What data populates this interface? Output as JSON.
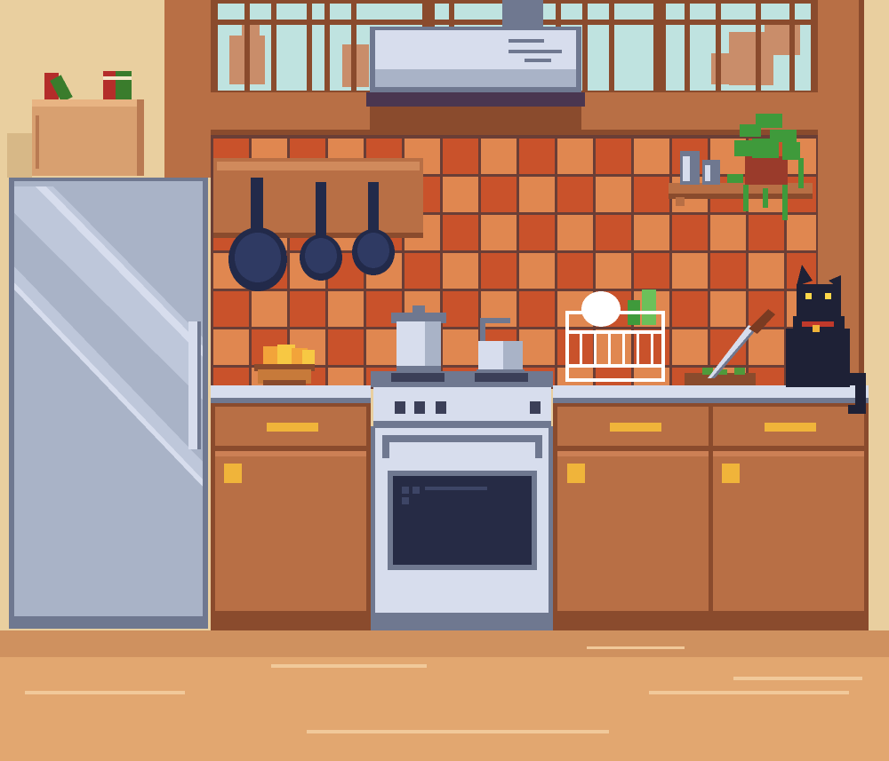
{
  "scene": {
    "kind": "pixel-art-kitchen",
    "objects": [
      "window",
      "range-hood",
      "tile-backsplash",
      "hanging-pans",
      "fridge",
      "books",
      "storage-box",
      "fruit-bowl",
      "stock-pot",
      "kettle",
      "dish-rack",
      "plant",
      "spice-jars",
      "knife",
      "cutting-board",
      "black-cat",
      "stove",
      "oven",
      "cabinets",
      "floor"
    ]
  },
  "colors": {
    "wall": "#e9cf9f",
    "wood": "#b86f45",
    "wood_dark": "#8a4b2d",
    "tile_a": "#c9522b",
    "tile_b": "#e08750",
    "grout": "#6a3e36",
    "steel": "#a9b3c7",
    "steel_light": "#d7dded",
    "steel_dark": "#6f7890",
    "oven_glass": "#262b45",
    "floor": "#e2a770",
    "floor_line": "#f1c99a",
    "handle": "#f0b43a",
    "cat": "#1e2136",
    "cat_eye": "#ffd84a",
    "plant": "#3f9a3b",
    "window_glass": "#bfe3e0",
    "tree": "#c98d6a"
  }
}
